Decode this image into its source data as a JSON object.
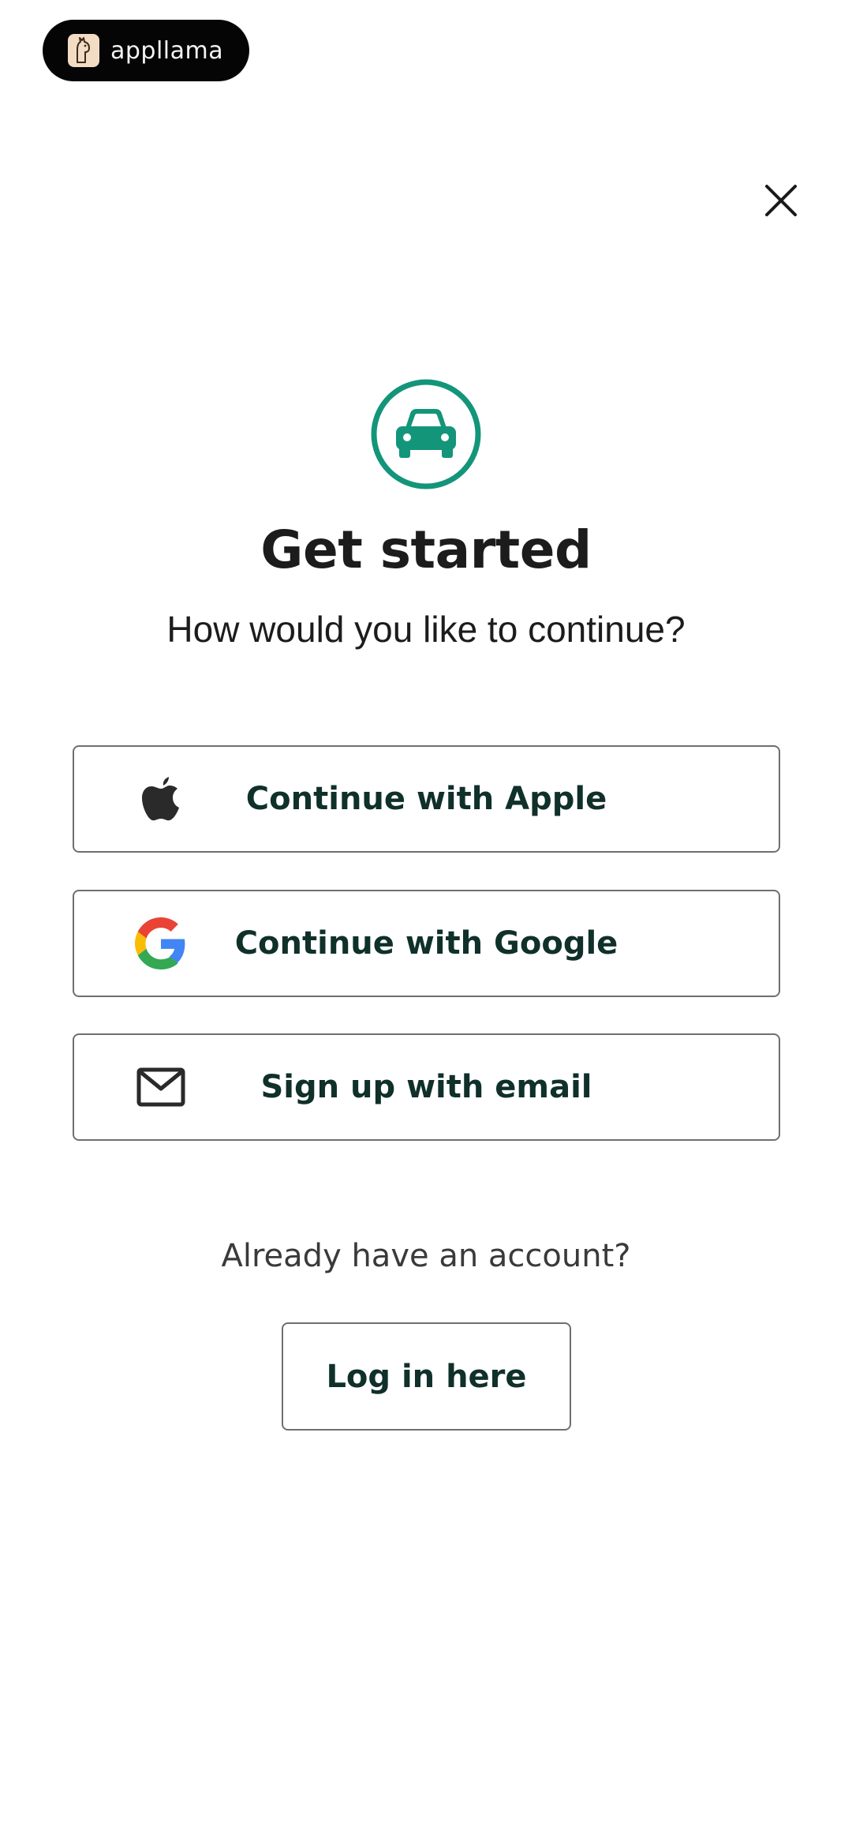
{
  "brand": {
    "name": "appllama",
    "logo_icon": "llama-logo-icon"
  },
  "header": {
    "close_icon": "close-icon"
  },
  "hero": {
    "icon": "car-icon",
    "accent_color": "#13957a",
    "title": "Get started",
    "subtitle": "How would you like to continue?"
  },
  "auth_options": {
    "apple": {
      "label": "Continue with Apple",
      "icon": "apple-icon"
    },
    "google": {
      "label": "Continue with Google",
      "icon": "google-icon"
    },
    "email": {
      "label": "Sign up with email",
      "icon": "envelope-icon"
    }
  },
  "login": {
    "prompt": "Already have an account?",
    "button_label": "Log in here"
  }
}
